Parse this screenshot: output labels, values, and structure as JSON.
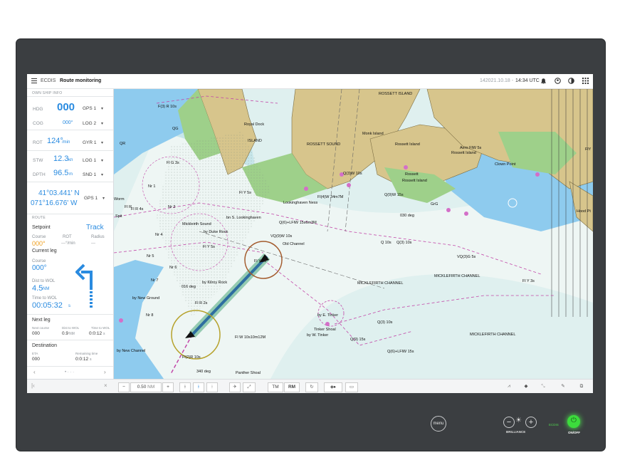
{
  "topbar": {
    "app": "ECDIS",
    "mode": "Route monitoring",
    "datetime_gray": "142021.10.18 -",
    "time": "14:34 UTC"
  },
  "ownship": {
    "section": "OWN SHIP INFO",
    "hdg": {
      "label": "HDG",
      "value": "000",
      "source": "GPS 1"
    },
    "cog": {
      "label": "COG",
      "value": "000°",
      "source": "LOG 2"
    },
    "rot": {
      "label": "ROT",
      "value": "124°",
      "unit": "/min",
      "source": "GYR 1"
    },
    "stw": {
      "label": "STW",
      "value": "12.3",
      "unit": "kn",
      "source": "LOG 1"
    },
    "dpth": {
      "label": "DPTH",
      "value": "96.5",
      "unit": "m",
      "source": "SND 1"
    },
    "lat": "41°03.441' N",
    "lon": "071°16.676' W",
    "pos_source": "GPS 1"
  },
  "route": {
    "section": "ROUTE",
    "setpoint": "Setpoint",
    "track": "Track",
    "course_lbl": "Course",
    "rot_lbl": "ROT",
    "radius_lbl": "Radius",
    "course_val": "000°",
    "rot_val": "---°/min",
    "radius_val": "---",
    "current_leg": "Current leg",
    "cl_course_lbl": "Course",
    "cl_course_val": "000°",
    "dist_lbl": "Dist to WOL",
    "dist_val": "4.5",
    "dist_unit": "NM",
    "time_lbl": "Time to WOL",
    "time_val": "00:05:32",
    "time_unit": "s",
    "next_leg": "Next leg",
    "nl_h1": "Next course",
    "nl_h2": "Dist to WOL",
    "nl_h3": "Time to WOL",
    "nl_v1": "000",
    "nl_v2": "0.9",
    "nl_v2u": "NM",
    "nl_v3": "0:0:12",
    "nl_v3u": "s",
    "destination": "Destination",
    "eta_lbl": "ETA",
    "rem_lbl": "Remaining time",
    "eta_val": "000",
    "rem_val": "0:0:12",
    "rem_unit": "s"
  },
  "bottombar": {
    "minus": "−",
    "scale": "0.50",
    "scale_unit": "NM",
    "plus": "+",
    "tm": "TM",
    "rm": "RM"
  },
  "hardware": {
    "menu": "menu",
    "brilliance": "BRILLIANCE",
    "ecdis": "ECDIS",
    "onoff": "ON/OFF"
  },
  "map_labels": [
    "ROSSETT ISLAND",
    "Royal Dock",
    "ROSSETT SOUND",
    "Monk Island",
    "Rossett Island",
    "Aero FlW 5s",
    "Rossett Island",
    "Clown Point",
    "Rossett",
    "Rossett Island",
    "QG",
    "QR",
    "F(3) R 10s",
    "Fl G 3s",
    "ISLAND",
    "Q(3)W 10s",
    "Q(9)W 15s",
    "Lookinghaven Ness",
    "Fl(4)W 34m7M",
    "030 deg",
    "GrG",
    "Nr 1",
    "Fl Y 5s",
    "Fl R 4s",
    "Mickleirth Sound",
    "bn S. Lookinghaven",
    "Q(6)+LFlW 15s6m3M",
    "by Duke Rock",
    "VQ(9)W 10s",
    "Old Channel",
    "Q 10s",
    "Q(3) 10s",
    "VQ(3)G 5s",
    "Nr 4",
    "Fl Y 5s",
    "Nr 5",
    "Fl Y 2s",
    "Nr 6",
    "MICKLEFIRTH CHANNEL",
    "MICKLEFIRTH CHANNEL",
    "Fl Y 3s",
    "Nr 7",
    "by Kilroy Rock",
    "016 deg",
    "by New Ground",
    "Fl R 2s",
    "Nr 8",
    "by E. Tinker",
    "Tinker Shoal",
    "Q(3) 10s",
    "by W. Tinker",
    "Q(9) 15s",
    "Q(6)+LFlW 15s",
    "MICKLEFIRTH CHANNEL",
    "Fl W 10s10m12M",
    "by New Channel",
    "Fl(2)R 10s",
    "340 deg",
    "Panther Shoal",
    "Hood Pt",
    "FlY",
    "Worm",
    "Spit",
    "Nr 2",
    "Fl R"
  ]
}
